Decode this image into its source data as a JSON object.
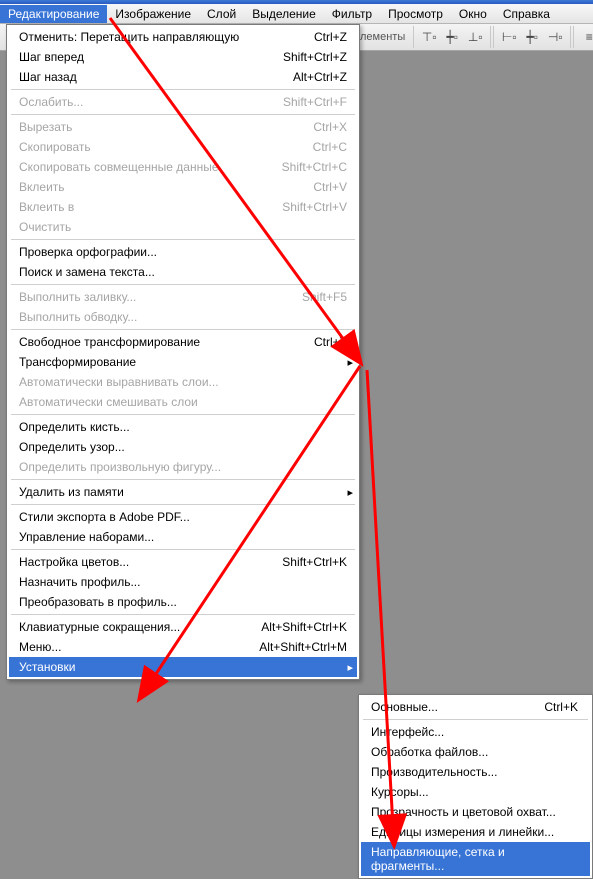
{
  "menubar": {
    "items": [
      {
        "label": "Редактирование",
        "active": true
      },
      {
        "label": "Изображение"
      },
      {
        "label": "Слой"
      },
      {
        "label": "Выделение"
      },
      {
        "label": "Фильтр"
      },
      {
        "label": "Просмотр"
      },
      {
        "label": "Окно"
      },
      {
        "label": "Справка"
      }
    ]
  },
  "toolbar": {
    "label_fragment": "лементы"
  },
  "edit_menu": {
    "groups": [
      [
        {
          "label": "Отменить: Перетащить направляющую",
          "shortcut": "Ctrl+Z"
        },
        {
          "label": "Шаг вперед",
          "shortcut": "Shift+Ctrl+Z"
        },
        {
          "label": "Шаг назад",
          "shortcut": "Alt+Ctrl+Z"
        }
      ],
      [
        {
          "label": "Ослабить...",
          "shortcut": "Shift+Ctrl+F",
          "disabled": true
        }
      ],
      [
        {
          "label": "Вырезать",
          "shortcut": "Ctrl+X",
          "disabled": true
        },
        {
          "label": "Скопировать",
          "shortcut": "Ctrl+C",
          "disabled": true
        },
        {
          "label": "Скопировать совмещенные данные",
          "shortcut": "Shift+Ctrl+C",
          "disabled": true
        },
        {
          "label": "Вклеить",
          "shortcut": "Ctrl+V",
          "disabled": true
        },
        {
          "label": "Вклеить в",
          "shortcut": "Shift+Ctrl+V",
          "disabled": true
        },
        {
          "label": "Очистить",
          "disabled": true
        }
      ],
      [
        {
          "label": "Проверка орфографии..."
        },
        {
          "label": "Поиск и замена текста..."
        }
      ],
      [
        {
          "label": "Выполнить заливку...",
          "shortcut": "Shift+F5",
          "disabled": true
        },
        {
          "label": "Выполнить обводку...",
          "disabled": true
        }
      ],
      [
        {
          "label": "Свободное трансформирование",
          "shortcut": "Ctrl+T"
        },
        {
          "label": "Трансформирование",
          "submenu": true
        },
        {
          "label": "Автоматически выравнивать слои...",
          "disabled": true
        },
        {
          "label": "Автоматически смешивать слои",
          "disabled": true
        }
      ],
      [
        {
          "label": "Определить кисть..."
        },
        {
          "label": "Определить узор..."
        },
        {
          "label": "Определить произвольную фигуру...",
          "disabled": true
        }
      ],
      [
        {
          "label": "Удалить из памяти",
          "submenu": true
        }
      ],
      [
        {
          "label": "Стили экспорта в Adobe PDF..."
        },
        {
          "label": "Управление наборами..."
        }
      ],
      [
        {
          "label": "Настройка цветов...",
          "shortcut": "Shift+Ctrl+K"
        },
        {
          "label": "Назначить профиль..."
        },
        {
          "label": "Преобразовать в профиль..."
        }
      ],
      [
        {
          "label": "Клавиатурные сокращения...",
          "shortcut": "Alt+Shift+Ctrl+K"
        },
        {
          "label": "Меню...",
          "shortcut": "Alt+Shift+Ctrl+M"
        },
        {
          "label": "Установки",
          "submenu": true,
          "highlight": true
        }
      ]
    ]
  },
  "prefs_submenu": {
    "groups": [
      [
        {
          "label": "Основные...",
          "shortcut": "Ctrl+K"
        }
      ],
      [
        {
          "label": "Интерфейс..."
        },
        {
          "label": "Обработка файлов..."
        },
        {
          "label": "Производительность..."
        },
        {
          "label": "Курсоры..."
        },
        {
          "label": "Прозрачность и цветовой охват..."
        },
        {
          "label": "Единицы измерения и линейки..."
        },
        {
          "label": "Направляющие, сетка и фрагменты...",
          "highlight": true
        }
      ]
    ]
  },
  "arrows": {
    "color": "#ff0000"
  }
}
